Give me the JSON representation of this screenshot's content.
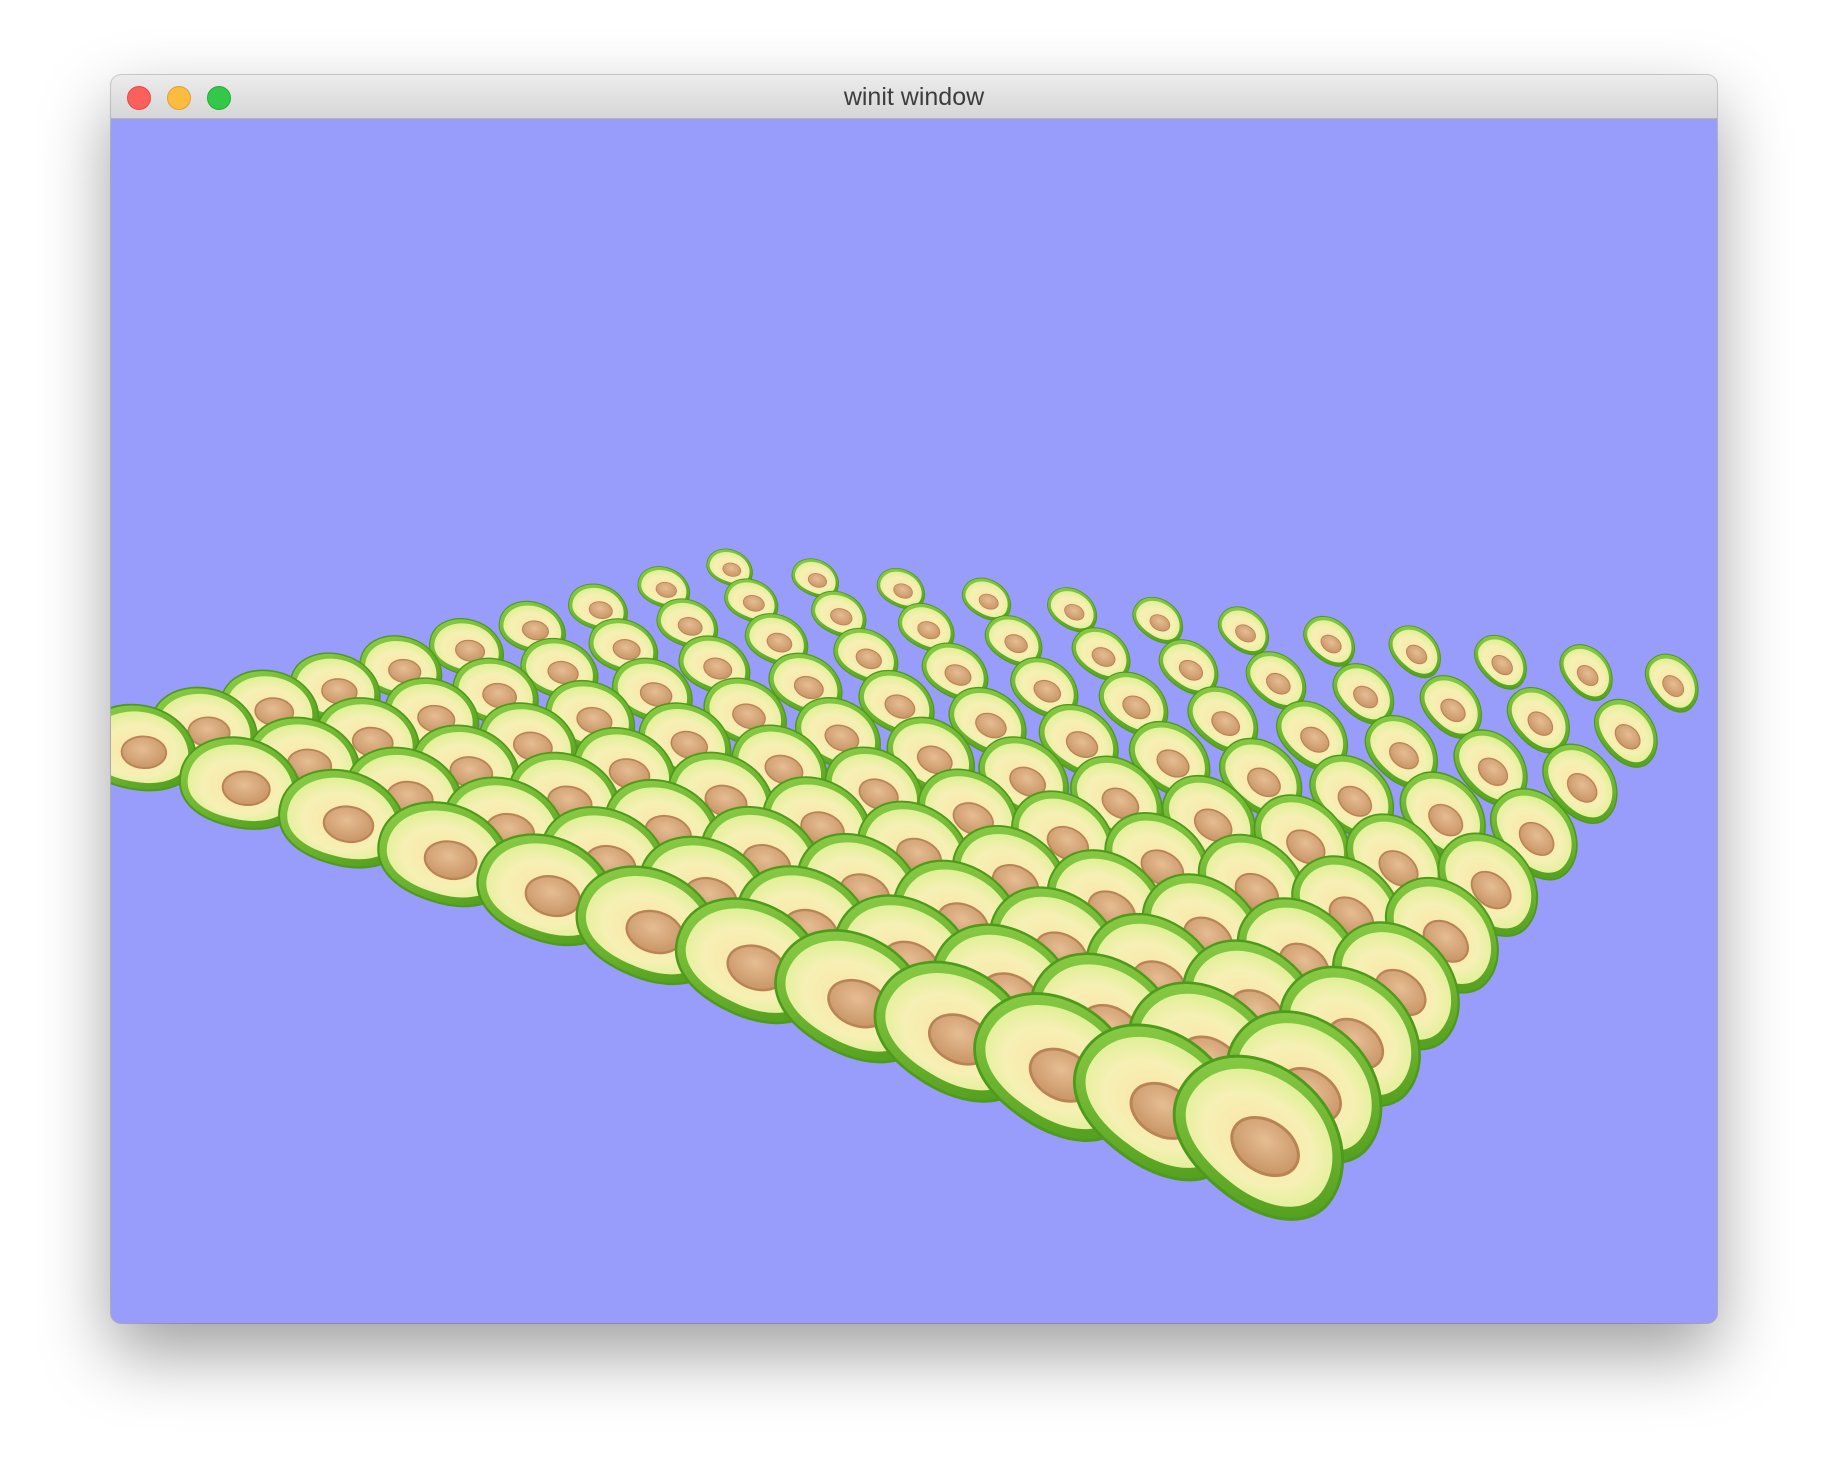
{
  "window": {
    "title": "winit window",
    "controls": [
      "close",
      "minimize",
      "zoom"
    ]
  },
  "scene": {
    "clear_color": "#989cfa",
    "object": "avocado",
    "object_colors": {
      "skin": "#6fbb2c",
      "skin_dark": "#4e9a1a",
      "flesh": "#e8f4a6",
      "flesh_inner": "#fbe3a6",
      "pit": "#d7a67a",
      "pit_edge": "#b88456"
    }
  }
}
